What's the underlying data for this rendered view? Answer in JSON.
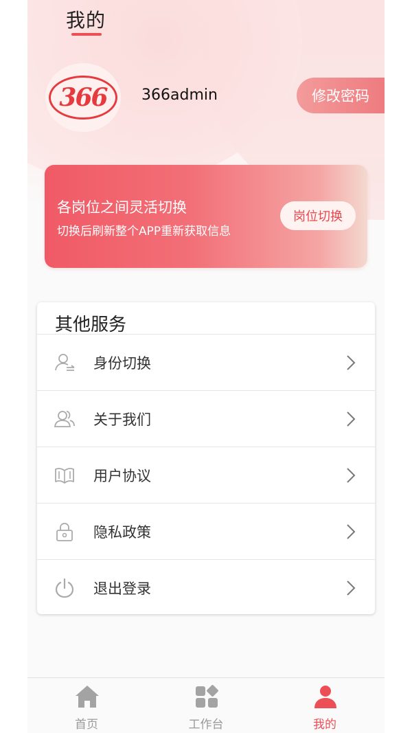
{
  "header": {
    "title": "我的"
  },
  "profile": {
    "avatar_text": "366",
    "username": "366admin",
    "change_password_label": "修改密码"
  },
  "role_switch": {
    "title": "各岗位之间灵活切换",
    "subtitle": "切换后刷新整个APP重新获取信息",
    "button_label": "岗位切换"
  },
  "services": {
    "title": "其他服务",
    "items": [
      {
        "label": "身份切换",
        "icon": "identity-switch-icon"
      },
      {
        "label": "关于我们",
        "icon": "users-icon"
      },
      {
        "label": "用户协议",
        "icon": "book-icon"
      },
      {
        "label": "隐私政策",
        "icon": "lock-icon"
      },
      {
        "label": "退出登录",
        "icon": "power-icon"
      }
    ]
  },
  "tabbar": {
    "items": [
      {
        "label": "首页",
        "icon": "home-icon",
        "active": false
      },
      {
        "label": "工作台",
        "icon": "workbench-icon",
        "active": false
      },
      {
        "label": "我的",
        "icon": "profile-icon",
        "active": true
      }
    ]
  },
  "colors": {
    "accent": "#ec4f55",
    "inactive_tab": "#9a9a9a"
  }
}
